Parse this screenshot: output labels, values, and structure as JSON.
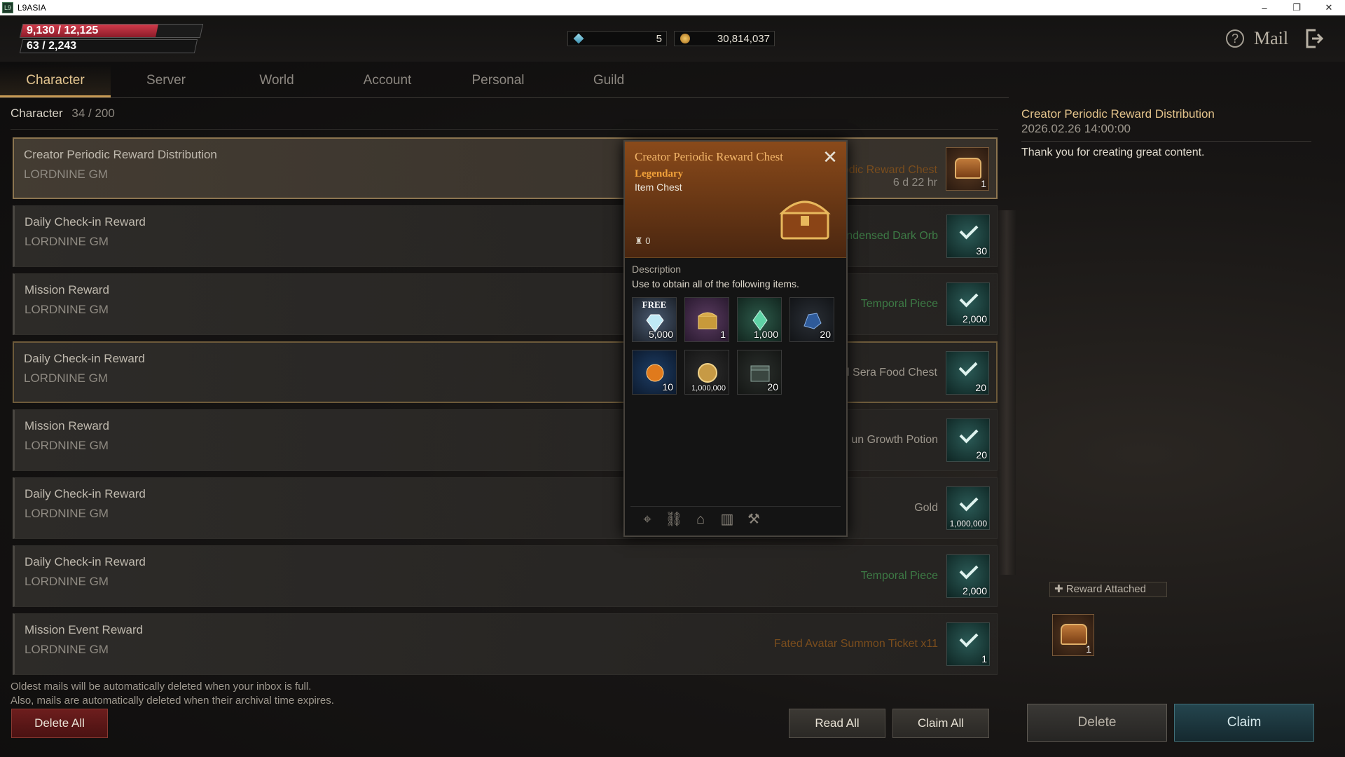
{
  "window": {
    "title": "L9ASIA",
    "app_icon": "L9",
    "controls": [
      "–",
      "❐",
      "✕"
    ]
  },
  "hud": {
    "hp_text": "9,130 / 12,125",
    "hp_fraction": 0.753,
    "mp_text": "63 / 2,243",
    "gems_value": "5",
    "gold_value": "30,814,037",
    "help_symbol": "?",
    "page_title": "Mail"
  },
  "tabs": [
    {
      "label": "Character",
      "active": true
    },
    {
      "label": "Server",
      "active": false
    },
    {
      "label": "World",
      "active": false
    },
    {
      "label": "Account",
      "active": false
    },
    {
      "label": "Personal",
      "active": false
    },
    {
      "label": "Guild",
      "active": false
    }
  ],
  "list_header": {
    "label": "Character",
    "count": "34 / 200"
  },
  "mails": [
    {
      "subject": "Creator Periodic Reward Distribution",
      "sender": "LORDNINE GM",
      "reward": "Creator Periodic Reward Chest",
      "time": "6 d 22 hr",
      "qty": "1",
      "icon": "chest-icon"
    },
    {
      "subject": "Daily Check-in Reward",
      "sender": "LORDNINE GM",
      "reward": "Condensed Dark Orb",
      "qty": "30",
      "icon": "claimed-check-icon"
    },
    {
      "subject": "Mission Reward",
      "sender": "LORDNINE GM",
      "reward": "Temporal Piece",
      "qty": "2,000",
      "icon": "claimed-check-icon"
    },
    {
      "subject": "Daily Check-in Reward",
      "sender": "LORDNINE GM",
      "reward": "El Sera Food Chest",
      "qty": "20",
      "icon": "claimed-check-icon"
    },
    {
      "subject": "Mission Reward",
      "sender": "LORDNINE GM",
      "reward": "un Growth Potion",
      "qty": "20",
      "icon": "claimed-check-icon"
    },
    {
      "subject": "Daily Check-in Reward",
      "sender": "LORDNINE GM",
      "reward": "Gold",
      "qty": "1,000,000",
      "icon": "claimed-check-icon"
    },
    {
      "subject": "Daily Check-in Reward",
      "sender": "LORDNINE GM",
      "reward": "Temporal Piece",
      "qty": "2,000",
      "icon": "claimed-check-icon"
    },
    {
      "subject": "Mission Event Reward",
      "sender": "LORDNINE GM",
      "reward": "Fated Avatar Summon Ticket x11",
      "qty": "1",
      "icon": "claimed-check-icon"
    }
  ],
  "notes": {
    "line1": "Oldest mails will be automatically deleted when your inbox is full.",
    "line2": "Also, mails are automatically deleted when their archival time expires."
  },
  "buttons": {
    "delete_all": "Delete All",
    "read_all": "Read All",
    "claim_all": "Claim All",
    "delete": "Delete",
    "claim": "Claim"
  },
  "tooltip": {
    "title": "Creator Periodic Reward Chest",
    "grade": "Legendary",
    "type": "Item Chest",
    "weight": "0",
    "desc_label": "Description",
    "desc": "Use to obtain all of the following items.",
    "items": [
      {
        "free": "FREE",
        "qty": "5,000",
        "icon": "diamond-icon"
      },
      {
        "qty": "1",
        "icon": "golden-chest-icon"
      },
      {
        "qty": "1,000",
        "icon": "crystal-icon"
      },
      {
        "qty": "20",
        "icon": "ore-icon"
      },
      {
        "qty": "10",
        "icon": "fire-orb-icon"
      },
      {
        "qty": "1,000,000",
        "icon": "gold-coin-icon"
      },
      {
        "qty": "20",
        "icon": "food-chest-icon"
      }
    ],
    "footer_icons": [
      "map-pin-icon",
      "link-icon",
      "bank-icon",
      "storage-icon",
      "craft-icon"
    ]
  },
  "detail": {
    "title": "Creator Periodic Reward Distribution",
    "date": "2026.02.26 14:00:00",
    "body": "Thank you for creating great content.",
    "reward_attached_label": "Reward Attached",
    "attached_qty": "1"
  }
}
